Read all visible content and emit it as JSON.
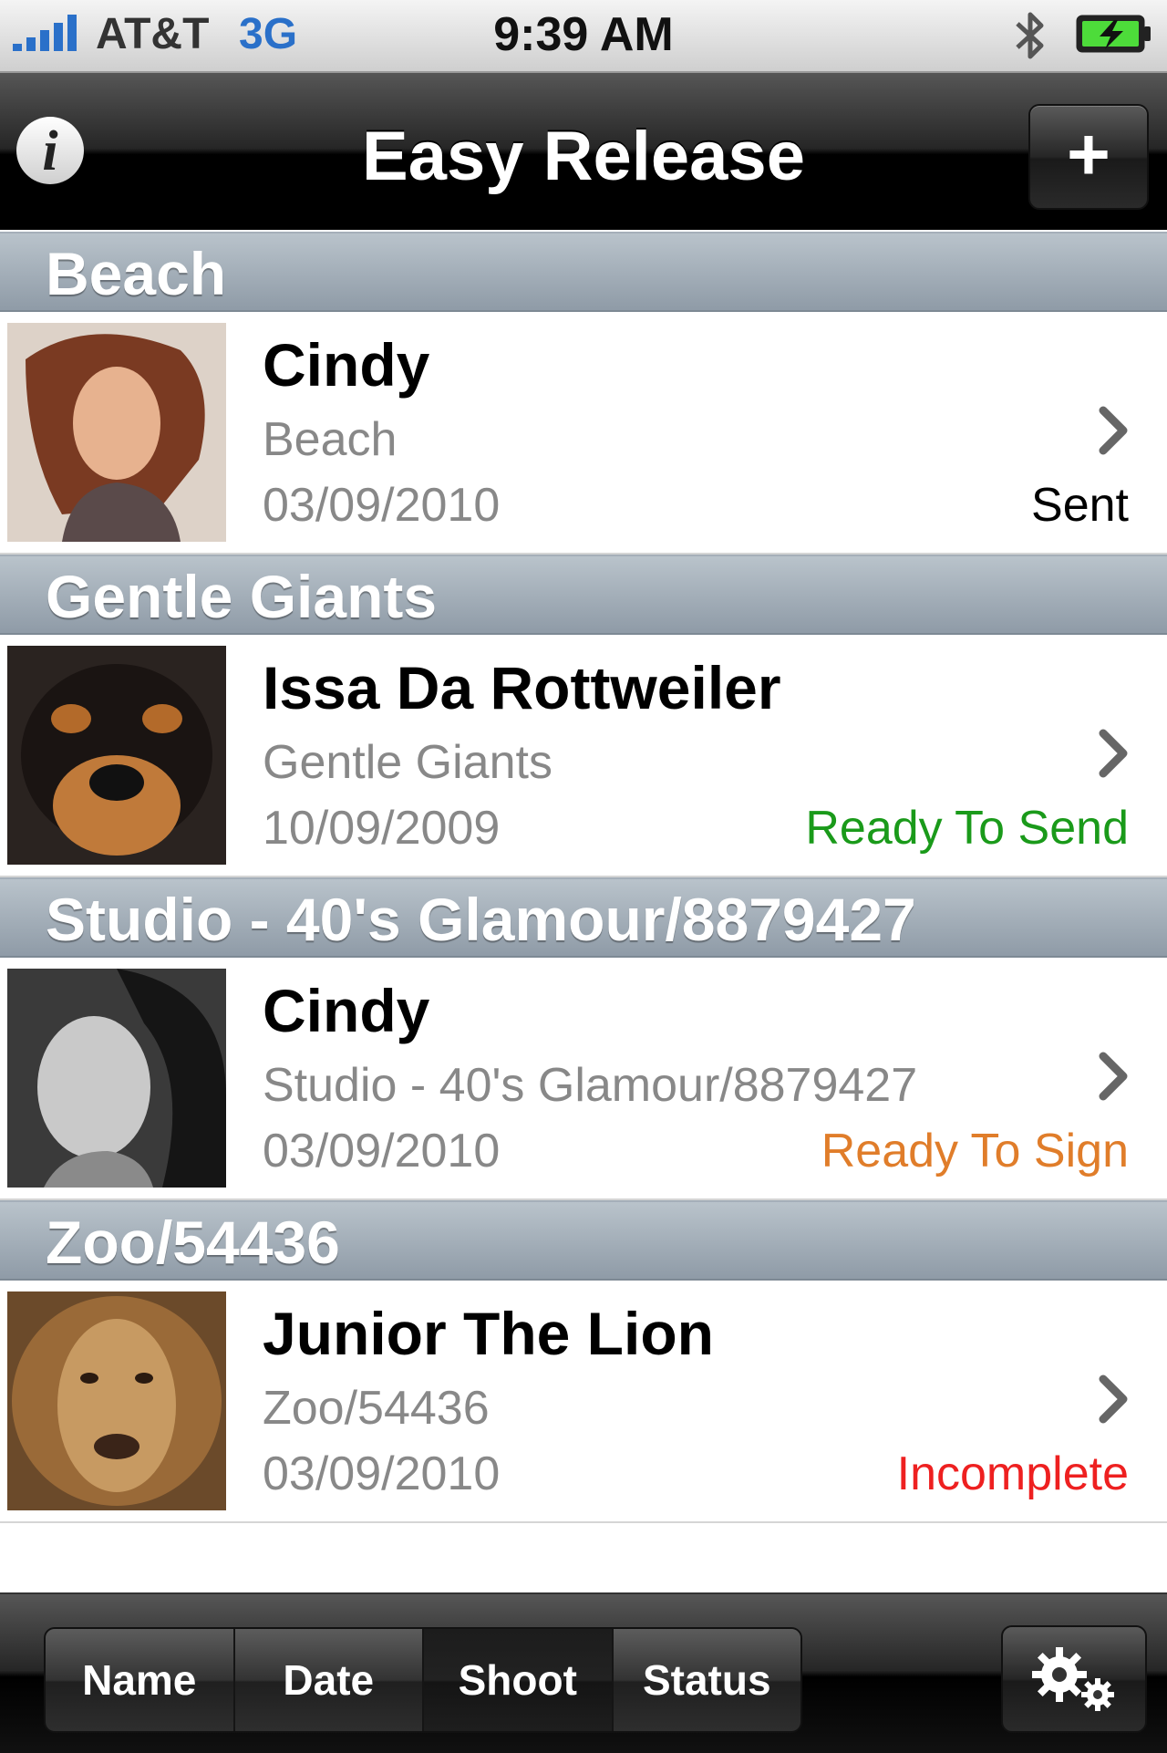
{
  "status_bar": {
    "carrier": "AT&T",
    "network": "3G",
    "time": "9:39 AM",
    "signal_icon": "signal-bars-icon",
    "bluetooth_icon": "bluetooth-icon",
    "battery_icon": "battery-charging-icon"
  },
  "nav": {
    "info_icon": "info-icon",
    "info_glyph": "i",
    "title": "Easy Release",
    "add_icon": "plus-icon",
    "add_glyph": "+"
  },
  "sections": [
    {
      "header": "Beach",
      "name": "Cindy",
      "shoot": "Beach",
      "date": "03/09/2010",
      "status": "Sent",
      "status_color": "#000000",
      "thumb_icon": "portrait-photo"
    },
    {
      "header": "Gentle Giants",
      "name": "Issa Da Rottweiler",
      "shoot": "Gentle Giants",
      "date": "10/09/2009",
      "status": "Ready To Send",
      "status_color": "#1a9a1a",
      "thumb_icon": "dog-photo"
    },
    {
      "header": "Studio - 40's Glamour/8879427",
      "name": "Cindy",
      "shoot": "Studio - 40's Glamour/8879427",
      "date": "03/09/2010",
      "status": "Ready To Sign",
      "status_color": "#e07d2a",
      "thumb_icon": "portrait-photo"
    },
    {
      "header": "Zoo/54436",
      "name": "Junior The Lion",
      "shoot": "Zoo/54436",
      "date": "03/09/2010",
      "status": "Incomplete",
      "status_color": "#ee2020",
      "thumb_icon": "lion-photo"
    }
  ],
  "toolbar": {
    "segments": [
      "Name",
      "Date",
      "Shoot",
      "Status"
    ],
    "selected_segment": "Shoot",
    "settings_icon": "gears-icon"
  }
}
